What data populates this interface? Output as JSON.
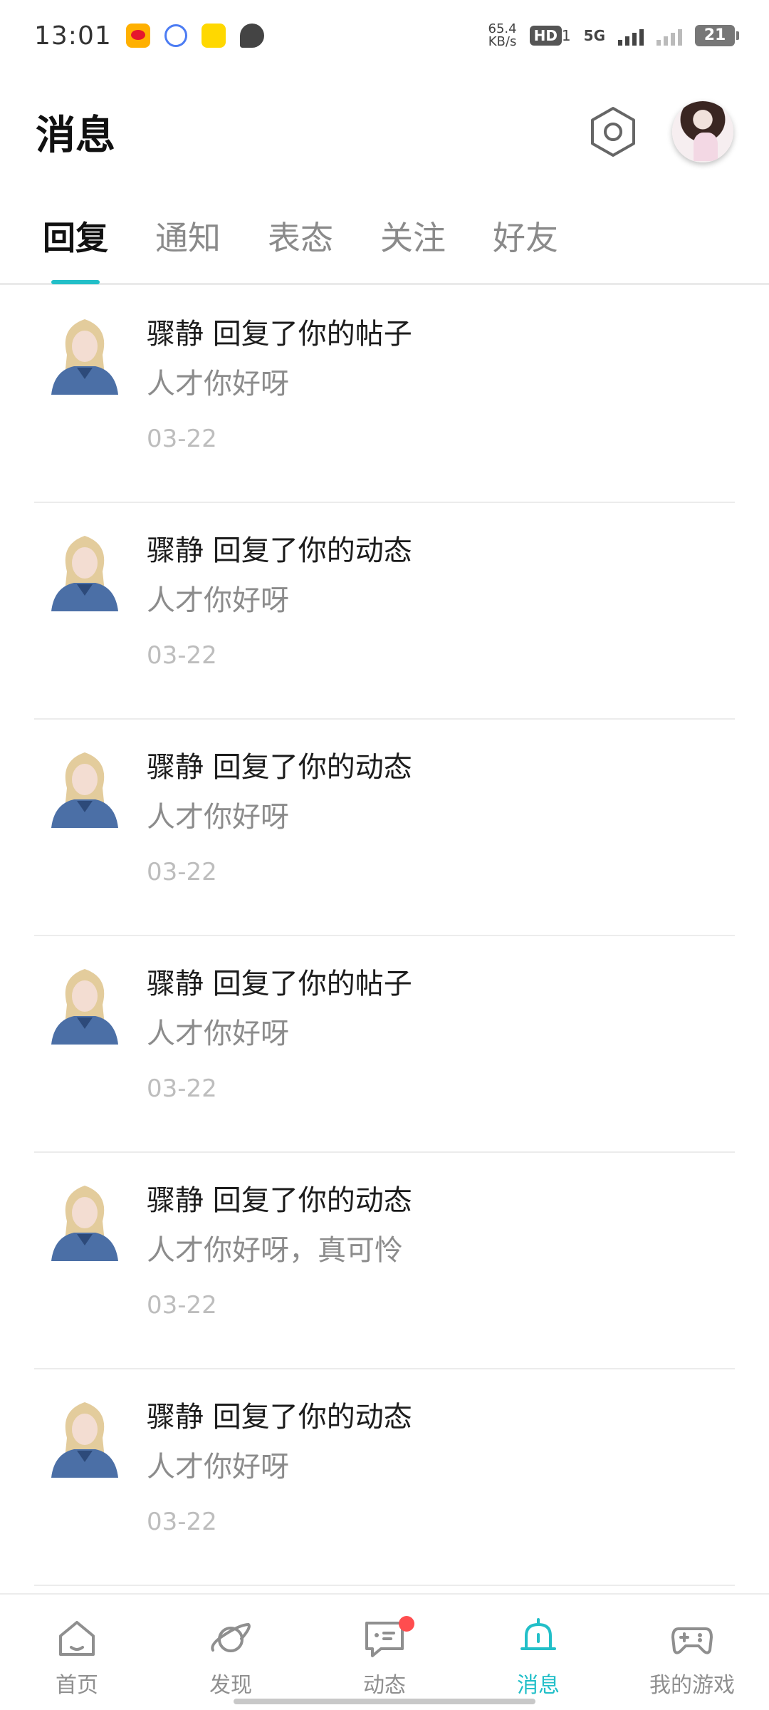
{
  "status_bar": {
    "time": "13:01",
    "speed_value": "65.4",
    "speed_unit": "KB/s",
    "hd_label": "HD",
    "hd_sub": "1",
    "network_label": "5G",
    "battery": "21"
  },
  "header": {
    "title": "消息",
    "settings_icon": "settings-hexagon-icon",
    "avatar_icon": "user-avatar"
  },
  "tabs": [
    {
      "label": "回复",
      "active": true
    },
    {
      "label": "通知",
      "active": false
    },
    {
      "label": "表态",
      "active": false
    },
    {
      "label": "关注",
      "active": false
    },
    {
      "label": "好友",
      "active": false
    }
  ],
  "messages": [
    {
      "title": "骤静 回复了你的帖子",
      "content": "人才你好呀",
      "date": "03-22"
    },
    {
      "title": "骤静 回复了你的动态",
      "content": "人才你好呀",
      "date": "03-22"
    },
    {
      "title": "骤静 回复了你的动态",
      "content": "人才你好呀",
      "date": "03-22"
    },
    {
      "title": "骤静 回复了你的帖子",
      "content": "人才你好呀",
      "date": "03-22"
    },
    {
      "title": "骤静 回复了你的动态",
      "content": "人才你好呀，真可怜",
      "date": "03-22"
    },
    {
      "title": "骤静 回复了你的动态",
      "content": "人才你好呀",
      "date": "03-22"
    }
  ],
  "bottom_nav": [
    {
      "label": "首页",
      "icon": "home-icon",
      "active": false,
      "badge": false
    },
    {
      "label": "发现",
      "icon": "planet-icon",
      "active": false,
      "badge": false
    },
    {
      "label": "动态",
      "icon": "chat-icon",
      "active": false,
      "badge": true
    },
    {
      "label": "消息",
      "icon": "bell-icon",
      "active": true,
      "badge": false
    },
    {
      "label": "我的游戏",
      "icon": "gamepad-icon",
      "active": false,
      "badge": false
    }
  ],
  "colors": {
    "accent": "#22bfc8",
    "badge": "#ff4d4f"
  }
}
